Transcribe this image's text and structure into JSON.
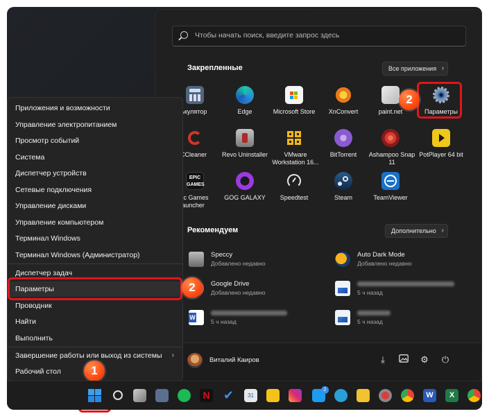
{
  "search": {
    "placeholder": "Чтобы начать поиск, введите запрос здесь"
  },
  "pinned": {
    "title": "Закрепленные",
    "all_apps_label": "Все приложения",
    "apps": [
      {
        "label": "Калькулятор",
        "icon": "calculator-icon",
        "color": "#5a6f8a"
      },
      {
        "label": "Edge",
        "icon": "edge-icon",
        "color": "#1aa0c8"
      },
      {
        "label": "Microsoft Store",
        "icon": "store-icon",
        "color": "#f3f3f3"
      },
      {
        "label": "XnConvert",
        "icon": "xnconvert-icon",
        "color": "#e88a1a"
      },
      {
        "label": "paint.net",
        "icon": "paintnet-icon",
        "color": "#dcdcdc"
      },
      {
        "label": "Параметры",
        "icon": "settings-gear-icon",
        "color": "#4a7fbf"
      },
      {
        "label": "CCleaner",
        "icon": "ccleaner-icon",
        "color": "#d1352a"
      },
      {
        "label": "Revo Uninstaller",
        "icon": "revo-icon",
        "color": "#b03a3a"
      },
      {
        "label": "VMware Workstation 16...",
        "icon": "vmware-icon",
        "color": "#e8b21a"
      },
      {
        "label": "BitTorrent",
        "icon": "bittorrent-icon",
        "color": "#8a5ad0"
      },
      {
        "label": "Ashampoo Snap 11",
        "icon": "ashampoo-icon",
        "color": "#d43a3a"
      },
      {
        "label": "PotPlayer 64 bit",
        "icon": "potplayer-icon",
        "color": "#f0c81a"
      },
      {
        "label": "Epic Games Launcher",
        "icon": "epic-games-icon",
        "color": "#2a2a2a"
      },
      {
        "label": "GOG GALAXY",
        "icon": "gog-icon",
        "color": "#8a2ad0"
      },
      {
        "label": "Speedtest",
        "icon": "speedtest-icon",
        "color": "#1a1a1a"
      },
      {
        "label": "Steam",
        "icon": "steam-icon",
        "color": "#1a3a5a"
      },
      {
        "label": "TeamViewer",
        "icon": "teamviewer-icon",
        "color": "#1a72c8"
      }
    ]
  },
  "recommended": {
    "title": "Рекомендуем",
    "more_label": "Дополнительно",
    "items": [
      {
        "name": "Speccy",
        "time": "Добавлено недавно",
        "icon": "speccy-icon",
        "color": "#8a8a8a"
      },
      {
        "name": "Auto Dark Mode",
        "time": "Добавлено недавно",
        "icon": "auto-dark-mode-icon",
        "color": "#e8a01a"
      },
      {
        "name": "Google Drive",
        "time": "Добавлено недавно",
        "icon": "google-drive-icon",
        "color": "#e03a2a"
      },
      {
        "name": "",
        "time": "5 ч назад",
        "icon": "image-file-icon",
        "color": "#4a8ad8"
      },
      {
        "name": "",
        "time": "5 ч назад",
        "icon": "word-doc-icon",
        "color": "#2a5ab8"
      },
      {
        "name": "",
        "time": "5 ч назад",
        "icon": "image-file-icon",
        "color": "#4a8ad8"
      }
    ]
  },
  "user": {
    "name": "Виталий Каиров"
  },
  "context_menu": {
    "items": [
      "Приложения и возможности",
      "Управление электропитанием",
      "Просмотр событий",
      "Система",
      "Диспетчер устройств",
      "Сетевые подключения",
      "Управление дисками",
      "Управление компьютером",
      "Терминал Windows",
      "Терминал Windows (Администратор)",
      "Диспетчер задач",
      "Параметры",
      "Проводник",
      "Найти",
      "Выполнить",
      "Завершение работы или выход из системы",
      "Рабочий стол"
    ]
  },
  "badges": {
    "one": "1",
    "two": "2"
  },
  "taskbar": {
    "twitter_badge": "2"
  },
  "colors": {
    "highlight": "#e0161c",
    "badge": "#ff4a12"
  }
}
